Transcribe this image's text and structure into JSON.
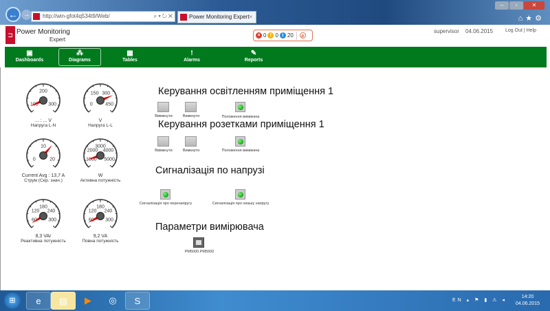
{
  "browser": {
    "url": "http://win-gfot4q534t9/Web/",
    "tab_title": "Power Monitoring Expert",
    "address_tools": "⌕ ▾ ↻ ✕",
    "tab_close": "×"
  },
  "header": {
    "brand_line1": "Power Monitoring",
    "brand_line2": "Expert",
    "alarms": {
      "high": "0",
      "medium": "0",
      "low": "20"
    },
    "user": "supervisor",
    "date": "04.06.2015",
    "links": "Log Out  |  Help"
  },
  "nav": [
    {
      "label": "Dashboards",
      "icon": "dashboard-icon",
      "glyph": "▣"
    },
    {
      "label": "Diagrams",
      "icon": "diagram-icon",
      "glyph": "⁂"
    },
    {
      "label": "Tables",
      "icon": "table-icon",
      "glyph": "▦"
    },
    {
      "label": "Alarms",
      "icon": "alarm-icon",
      "glyph": "!"
    },
    {
      "label": "Reports",
      "icon": "reports-icon",
      "glyph": "✎"
    }
  ],
  "gauges": [
    {
      "ticks": [
        "100",
        "200",
        "300"
      ],
      "value": "... : ... V",
      "label": "Напруга L-N",
      "needle_fraction": 0.08
    },
    {
      "ticks": [
        "0",
        "150",
        "300",
        "450"
      ],
      "value": "V",
      "label": "Напруга L-L",
      "needle_fraction": 0.75
    },
    {
      "ticks": [
        "0",
        "10",
        "20"
      ],
      "value": "Current Avg : 13,7 A",
      "label": "Струм (Сер. знач.)",
      "needle_fraction": 0.65
    },
    {
      "ticks": [
        "1000",
        "2000",
        "3000",
        "4000",
        "5000"
      ],
      "value": "W",
      "label": "Активна потужність",
      "needle_fraction": 0.1
    },
    {
      "ticks": [
        "60",
        "120",
        "180",
        "240",
        "300"
      ],
      "value": "8,3 VAr",
      "label": "Реактивна потужність",
      "needle_fraction": 0.05
    },
    {
      "ticks": [
        "60",
        "120",
        "180",
        "240",
        "300"
      ],
      "value": "9,2 VA",
      "label": "Повна потужність",
      "needle_fraction": 0.06
    }
  ],
  "sections": {
    "lighting": {
      "title": "Керування освітленням приміщення 1",
      "on": "Ввімкнути",
      "off": "Вимкнути",
      "status": "Положення вимикача"
    },
    "sockets": {
      "title": "Керування розетками приміщення 1",
      "on": "Ввімкнути",
      "off": "Вимкнути",
      "status": "Положення вимикача"
    },
    "voltage": {
      "title": "Сигналізація по напрузі",
      "over": "Сигналізація про перенапругу",
      "under": "Сигналізація про низьку напругу"
    },
    "meter": {
      "title": "Параметри вимірювача",
      "device": "PM5000.PM5500"
    }
  },
  "taskbar": {
    "tray": "EN ▴ ⚑ ▮ ⚠ ◂",
    "time": "14:20",
    "date": "04.06.2015"
  },
  "colors": {
    "nav_green": "#007a1d",
    "brand_red": "#c8102e"
  }
}
